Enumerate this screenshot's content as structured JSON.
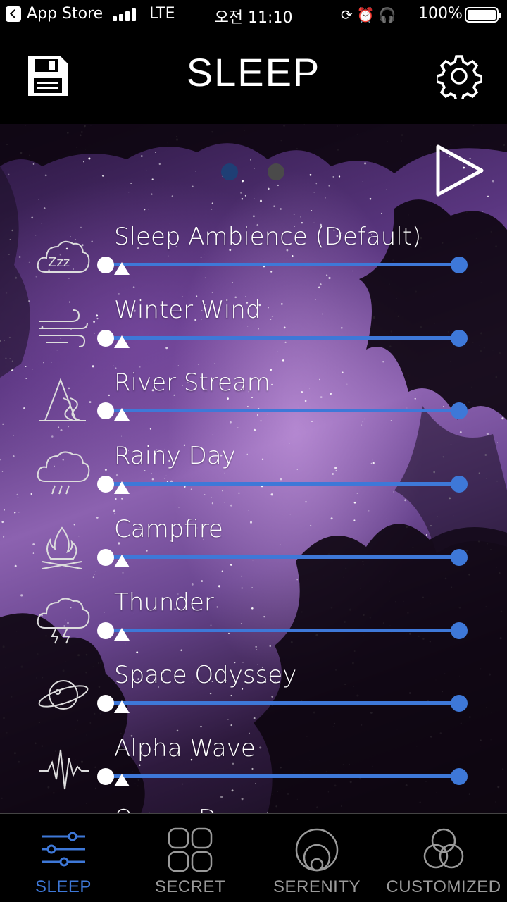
{
  "status_bar": {
    "back_label": "App Store",
    "carrier": "LTE",
    "time": "오전 11:10",
    "battery": "100%",
    "icons": [
      "orientation-lock-icon",
      "alarm-icon",
      "headphones-icon"
    ]
  },
  "nav": {
    "title": "SLEEP",
    "left_icon": "save-icon",
    "right_icon": "gear-icon"
  },
  "pager": {
    "page_count": 2,
    "current_page": 1
  },
  "player": {
    "icon": "play-icon"
  },
  "sounds": [
    {
      "label": "Sleep Ambience (Default)",
      "icon": "zzz-cloud-icon"
    },
    {
      "label": "Winter Wind",
      "icon": "wind-icon"
    },
    {
      "label": "River Stream",
      "icon": "river-icon"
    },
    {
      "label": "Rainy Day",
      "icon": "rain-cloud-icon"
    },
    {
      "label": "Campfire",
      "icon": "campfire-icon"
    },
    {
      "label": "Thunder",
      "icon": "thunder-cloud-icon"
    },
    {
      "label": "Space Odyssey",
      "icon": "planet-icon"
    },
    {
      "label": "Alpha Wave",
      "icon": "wave-icon"
    }
  ],
  "colors": {
    "accent": "#3e78d8",
    "inactive_tab": "#9a9a9a",
    "background": "#000000"
  },
  "tabs": [
    {
      "label": "SLEEP",
      "icon": "sliders-icon",
      "active": true
    },
    {
      "label": "SECRET",
      "icon": "four-squares-icon",
      "active": false
    },
    {
      "label": "SERENITY",
      "icon": "nested-circles-icon",
      "active": false
    },
    {
      "label": "CUSTOMIZED",
      "icon": "venn-circles-icon",
      "active": false
    }
  ]
}
